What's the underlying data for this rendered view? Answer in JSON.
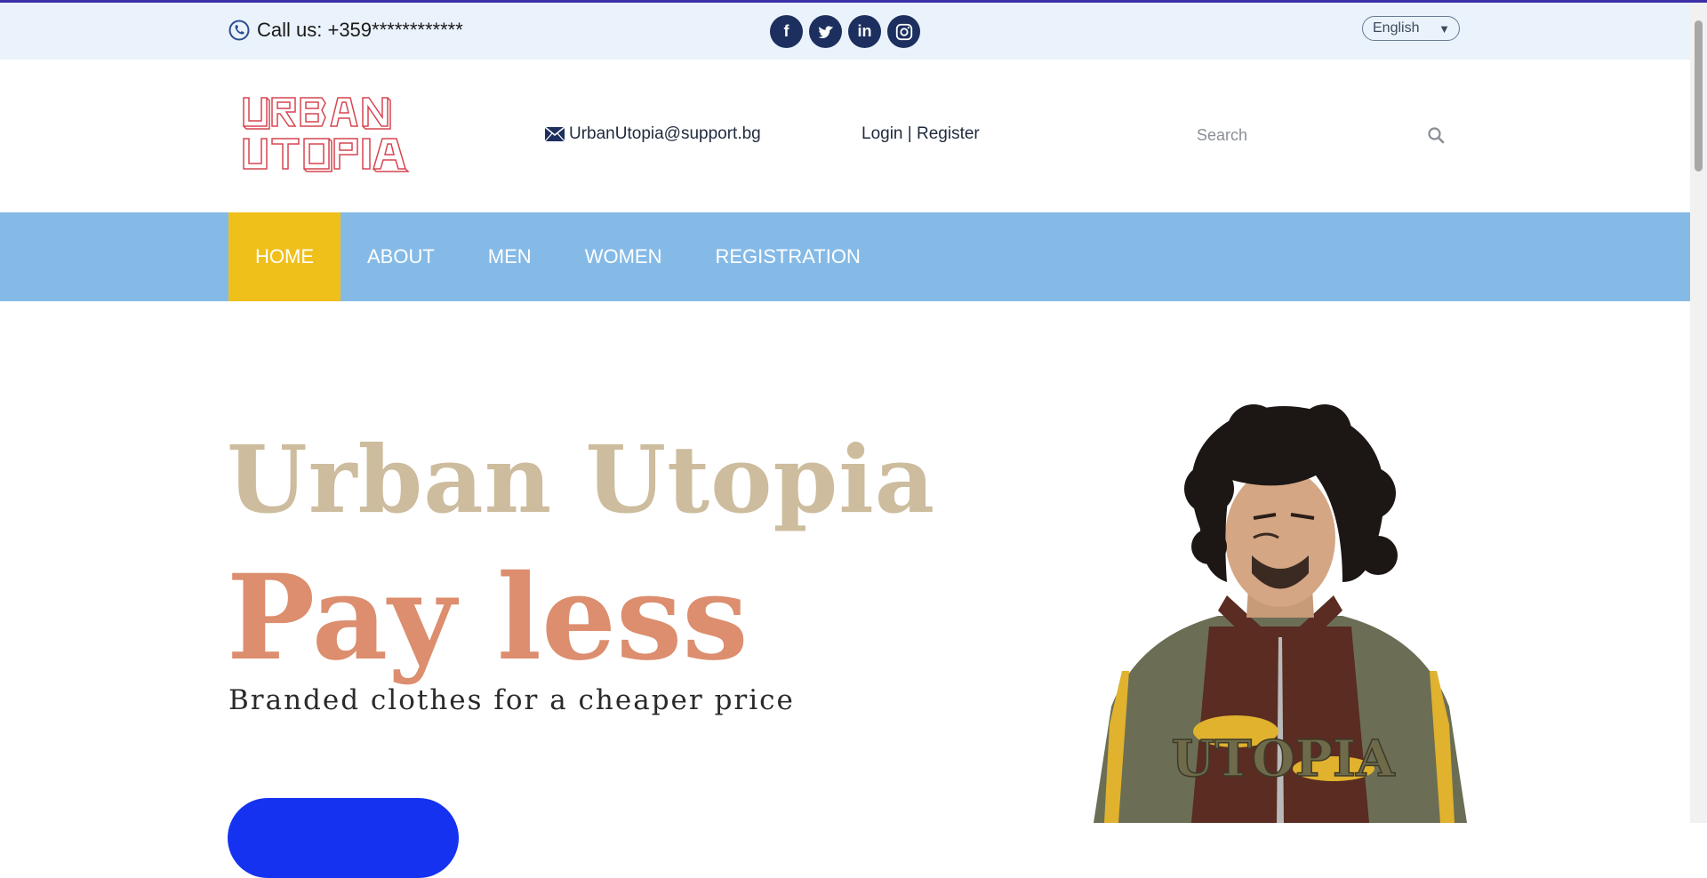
{
  "topbar": {
    "phone_text": "Call us: +359************",
    "social_icons": [
      "facebook-icon",
      "twitter-icon",
      "linkedin-icon",
      "instagram-icon"
    ],
    "social_glyphs": [
      "f",
      "t",
      "in",
      "◎"
    ],
    "language": "English",
    "language_arrow": "▼"
  },
  "header": {
    "logo_text": "URBAN UTOPIA",
    "email": "UrbanUtopia@support.bg",
    "login": "Login",
    "separator": "|",
    "register": "Register",
    "search_placeholder": "Search"
  },
  "nav": {
    "items": [
      {
        "label": "HOME",
        "active": true
      },
      {
        "label": "ABOUT",
        "active": false
      },
      {
        "label": "MEN",
        "active": false
      },
      {
        "label": "WOMEN",
        "active": false
      },
      {
        "label": "REGISTRATION",
        "active": false
      }
    ]
  },
  "hero": {
    "title": "Urban Utopia",
    "headline": "Pay less",
    "subtitle": "Branded clothes for a cheaper price",
    "jacket_text": "UTOPIA"
  },
  "colors": {
    "accent_bar": "#3b2fa8",
    "topbar_bg": "#eaf2fb",
    "nav_bg": "#85bae6",
    "nav_active": "#f0c01a",
    "title_color": "#cdbc9d",
    "headline_color": "#dc8e6e",
    "button_color": "#1532f0",
    "social_bg": "#1c2f5e"
  }
}
